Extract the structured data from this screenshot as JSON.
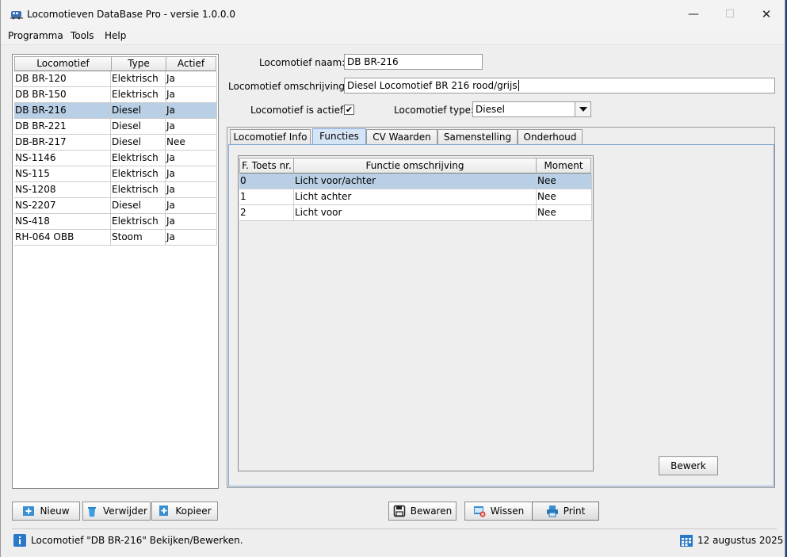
{
  "window": {
    "title": "Locomotieven DataBase Pro - versie 1.0.0.0",
    "minimize": "—",
    "maximize": "☐",
    "close": "✕"
  },
  "menu": [
    "Programma",
    "Tools",
    "Help"
  ],
  "loco_table": {
    "columns": [
      "Locomotief",
      "Type",
      "Actief"
    ],
    "rows": [
      [
        "DB BR-120",
        "Elektrisch",
        "Ja"
      ],
      [
        "DB BR-150",
        "Elektrisch",
        "Ja"
      ],
      [
        "DB BR-216",
        "Diesel",
        "Ja"
      ],
      [
        "DB BR-221",
        "Diesel",
        "Ja"
      ],
      [
        "DB-BR-217",
        "Diesel",
        "Nee"
      ],
      [
        "NS-1146",
        "Elektrisch",
        "Ja"
      ],
      [
        "NS-115",
        "Elektrisch",
        "Ja"
      ],
      [
        "NS-1208",
        "Elektrisch",
        "Ja"
      ],
      [
        "NS-2207",
        "Diesel",
        "Ja"
      ],
      [
        "NS-418",
        "Elektrisch",
        "Ja"
      ],
      [
        "RH-064 OBB",
        "Stoom",
        "Ja"
      ]
    ],
    "selected_index": 2
  },
  "form": {
    "naam_label": "Locomotief naam:",
    "naam_value": "DB BR-216",
    "omschrijving_label": "Locomotief omschrijving:",
    "omschrijving_value": "Diesel Locomotief BR 216 rood/grijs",
    "actief_label": "Locomotief is actief:",
    "actief_checked": "✔",
    "type_label": "Locomotief type:",
    "type_value": "Diesel"
  },
  "tabs": [
    "Locomotief Info",
    "Functies",
    "CV Waarden",
    "Samenstelling",
    "Onderhoud"
  ],
  "active_tab": 1,
  "functions_table": {
    "columns": [
      "F. Toets nr.",
      "Functie omschrijving",
      "Moment"
    ],
    "rows": [
      [
        "0",
        "Licht voor/achter",
        "Nee"
      ],
      [
        "1",
        "Licht achter",
        "Nee"
      ],
      [
        "2",
        "Licht voor",
        "Nee"
      ]
    ],
    "selected_index": 0
  },
  "buttons": {
    "bewerk": "Bewerk",
    "nieuw": "Nieuw",
    "verwijder": "Verwijder",
    "kopieer": "Kopieer",
    "bewaren": "Bewaren",
    "wissen": "Wissen",
    "print": "Print"
  },
  "status": {
    "message": "Locomotief \"DB BR-216\" Bekijken/Bewerken.",
    "date": "12 augustus 2025"
  },
  "colors": {
    "selection": "#b8cfe5",
    "active_tab": "#d6e5f5",
    "tab_border": "#7ea6d6"
  }
}
